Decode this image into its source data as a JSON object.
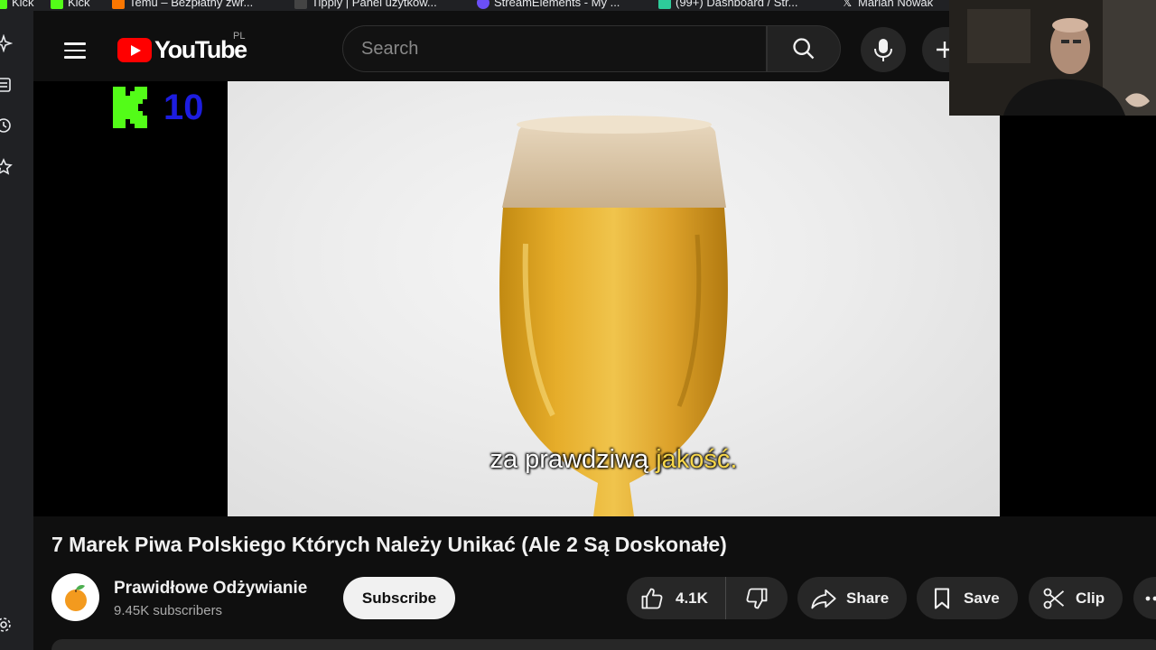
{
  "bookmarks": [
    {
      "label": "Kick",
      "color": "#53fc18"
    },
    {
      "label": "Kick",
      "color": "#53fc18"
    },
    {
      "label": "Temu – Bezpłatny zwr...",
      "color": "#fb7701"
    },
    {
      "label": "Tipply | Panel użytkow...",
      "color": "#ffffff"
    },
    {
      "label": "StreamElements - My ...",
      "color": "#6b4ff7"
    },
    {
      "label": "(99+) Dashboard / Str...",
      "color": "#2ecc9a"
    },
    {
      "label": "Marian Nowak",
      "color": "#ffffff"
    }
  ],
  "header": {
    "logo_text": "YouTube",
    "country_code": "PL",
    "search_placeholder": "Search"
  },
  "overlay": {
    "kick_count": "10"
  },
  "video": {
    "subtitle_main": "za prawdziwą ",
    "subtitle_highlight": "jakość.",
    "title": "7 Marek Piwa Polskiego Których Należy Unikać (Ale 2 Są Doskonałe)"
  },
  "channel": {
    "name": "Prawidłowe Odżywianie",
    "subscribers": "9.45K subscribers",
    "subscribe_label": "Subscribe"
  },
  "actions": {
    "likes": "4.1K",
    "share_label": "Share",
    "save_label": "Save",
    "clip_label": "Clip"
  },
  "colors": {
    "background": "#0f0f0f",
    "brand_red": "#ff0000",
    "kick_green": "#53fc18",
    "subtitle_highlight": "#f6d64a"
  }
}
